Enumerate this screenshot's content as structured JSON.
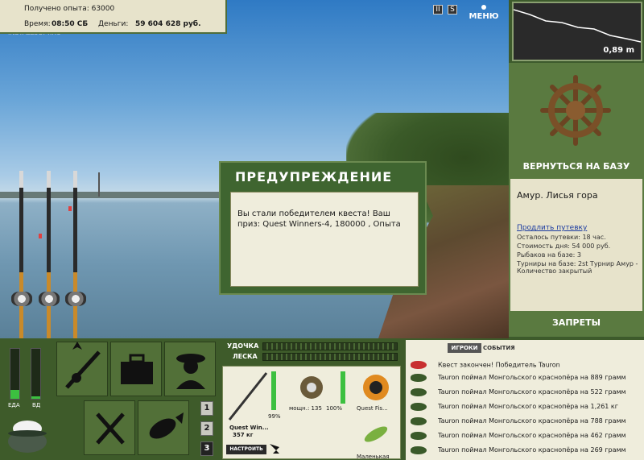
{
  "info": {
    "exp": "Получено опыта: 63000",
    "time_label": "Время:",
    "time_value": "08:50 СБ",
    "money_label": "Деньги:",
    "money_value": "59 604 628 руб."
  },
  "watermark": "INSTALLSOFT.RU",
  "top_buttons": {
    "pause": "II",
    "s": "S",
    "menu": "МЕНЮ"
  },
  "depth": {
    "value": "0,89 m"
  },
  "right": {
    "return": "ВЕРНУТЬСЯ НА БАЗУ",
    "base_name": "Амур. Лисья гора",
    "extend": "Продлить путевку",
    "lines": [
      "Осталось путевки: 18 час.",
      "Стоимость дня: 54 000 руб.",
      "Рыбаков на базе: 3",
      "Турниры на базе: 2st Турнир Амур - Количество закрытый"
    ],
    "bans": "ЗАПРЕТЫ"
  },
  "dialog": {
    "title": "ПРЕДУПРЕЖДЕНИЕ",
    "body": "Вы стали победителем квеста! Ваш приз: Quest Winners-4, 180000 , Опыта"
  },
  "meters": {
    "food_label": "ЕДА",
    "water_label": "ВД",
    "food_level": 0.18,
    "water_level": 0.05
  },
  "slots": [
    "1",
    "2",
    "3"
  ],
  "gauges": {
    "rod_label": "УДОЧКА",
    "line_label": "ЛЕСКА"
  },
  "tackle": {
    "rod_name": "Quest Win...",
    "rod_weight": "357 кг",
    "rod_pct": "99%",
    "setup": "НАСТРОИТЬ",
    "reel_power": "мощн.: 135",
    "reel_pct": "100%",
    "line_name": "Quest Fis...",
    "lure_name": "Маленькая"
  },
  "log": {
    "tab_players": "ИГРОКИ",
    "tab_events": "СОБЫТИЯ",
    "header": "Квест закончен! Победитель Tauron",
    "rows": [
      "Tauron поймал Монгольского краснопёра на 889 грамм",
      "Tauron поймал Монгольского краснопёра на 522 грамм",
      "Tauron поймал Монгольского краснопёра на 1,261 кг",
      "Tauron поймал Монгольского краснопёра на 788 грамм",
      "Tauron поймал Монгольского краснопёра на 462 грамм",
      "Tauron поймал Монгольского краснопёра на 269 грамм"
    ]
  },
  "colors": {
    "panel_green": "#3e5b2a",
    "panel_cream": "#efeddc",
    "meter_green": "#3cc040"
  }
}
